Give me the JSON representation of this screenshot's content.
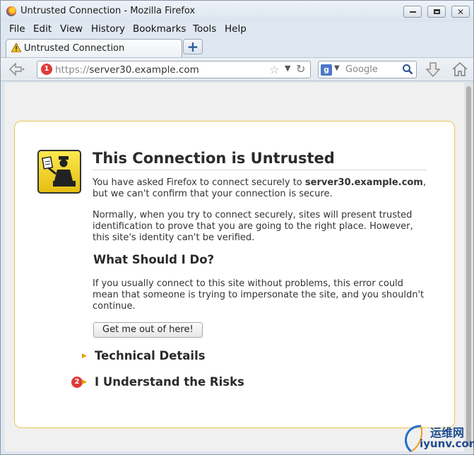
{
  "window": {
    "title": "Untrusted Connection - Mozilla Firefox"
  },
  "menu": [
    "File",
    "Edit",
    "View",
    "History",
    "Bookmarks",
    "Tools",
    "Help"
  ],
  "tab": {
    "label": "Untrusted Connection"
  },
  "urlbar": {
    "scheme": "https://",
    "host": "server30.example.com",
    "badge": "1"
  },
  "search": {
    "placeholder": "Google"
  },
  "page": {
    "title": "This Connection is Untrusted",
    "p1_prefix": "You have asked Firefox to connect securely to ",
    "p1_host": "server30.example.com",
    "p1_suffix": ", but we can't confirm that your connection is secure.",
    "p2": "Normally, when you try to connect securely, sites will present trusted identification to prove that you are going to the right place. However, this site's identity can't be verified.",
    "what_heading": "What Should I Do?",
    "p3": "If you usually connect to this site without problems, this error could mean that someone is trying to impersonate the site, and you shouldn't continue.",
    "button_label": "Get me out of here!",
    "technical_details": "Technical Details",
    "understand_risks": "I Understand the Risks",
    "risks_badge": "2"
  },
  "watermark": {
    "cn": "运维网",
    "en": "iyunv.com"
  },
  "colors": {
    "accent_badge": "#e03a3a",
    "card_border": "#e9c84e",
    "triangle": "#e0a000"
  },
  "icons": [
    "firefox-logo",
    "warning-icon",
    "back-arrow-icon",
    "star-icon",
    "reload-icon",
    "google-icon",
    "search-icon",
    "download-icon",
    "home-icon",
    "certificate-officer-icon"
  ]
}
